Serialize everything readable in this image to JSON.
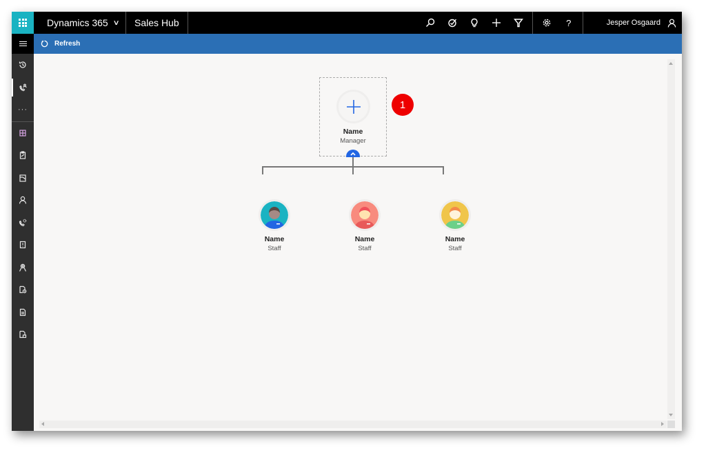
{
  "topbar": {
    "app_launcher_icon": "waffle-icon",
    "app_name": "Dynamics 365",
    "app_chevron": "chevron-down-icon",
    "area_name": "Sales Hub",
    "icons": [
      "search-icon",
      "task-target-icon",
      "lightbulb-icon",
      "plus-icon",
      "filter-icon"
    ],
    "settings_icon": "gear-icon",
    "help_icon": "question-icon",
    "help_glyph": "?",
    "user_name": "Jesper Osgaard",
    "user_icon": "person-icon"
  },
  "command_bar": {
    "refresh_label": "Refresh",
    "refresh_icon": "refresh-icon"
  },
  "sidebar": {
    "menu_icon": "hamburger-icon",
    "items": [
      {
        "name": "recent",
        "icon": "history-icon",
        "active": false
      },
      {
        "name": "pinned-phone-contact",
        "icon": "phone-person-icon",
        "active": true
      },
      {
        "name": "more",
        "icon": "ellipsis-icon",
        "label": "···",
        "active": false
      },
      {
        "name": "dashboards",
        "icon": "dashboard-icon",
        "active": false
      },
      {
        "name": "activities",
        "icon": "clipboard-icon",
        "active": false
      },
      {
        "name": "accounts",
        "icon": "building-icon",
        "active": false
      },
      {
        "name": "contacts",
        "icon": "person-icon",
        "active": false
      },
      {
        "name": "leads",
        "icon": "phone-gear-icon",
        "active": false
      },
      {
        "name": "opportunities",
        "icon": "alert-document-icon",
        "active": false
      },
      {
        "name": "competitors",
        "icon": "person-target-icon",
        "active": false
      },
      {
        "name": "quotes",
        "icon": "document-clock-icon",
        "active": false
      },
      {
        "name": "orders",
        "icon": "document-list-icon",
        "active": false
      },
      {
        "name": "invoices",
        "icon": "document-money-icon",
        "active": false
      }
    ]
  },
  "org_chart": {
    "manager": {
      "name": "Name",
      "title": "Manager",
      "add_icon": "plus-icon",
      "collapse_icon": "chevron-up-icon"
    },
    "callout_badge": "1",
    "staff": [
      {
        "name": "Name",
        "title": "Staff",
        "avatar": "male-avatar-teal",
        "bg": "#1ab3c2",
        "hair": "#5a4a44",
        "face": "#a68a85",
        "shirt": "#2266e3"
      },
      {
        "name": "Name",
        "title": "Staff",
        "avatar": "female-avatar-red",
        "bg": "#f88b7e",
        "hair": "#f0505a",
        "face": "#ffe3b0",
        "shirt": "#e85a5a"
      },
      {
        "name": "Name",
        "title": "Staff",
        "avatar": "female-avatar-yellow",
        "bg": "#f0c54a",
        "hair": "#f48a4a",
        "face": "#fff3dc",
        "shirt": "#6cd089"
      }
    ]
  },
  "colors": {
    "topbar_bg": "#000000",
    "launcher_bg": "#1ab3c2",
    "command_bar_bg": "#2b6fb5",
    "sidebar_bg": "#2f2f2f",
    "canvas_bg": "#f8f7f6",
    "accent_blue": "#2266e3",
    "badge_red": "#ee0000"
  }
}
